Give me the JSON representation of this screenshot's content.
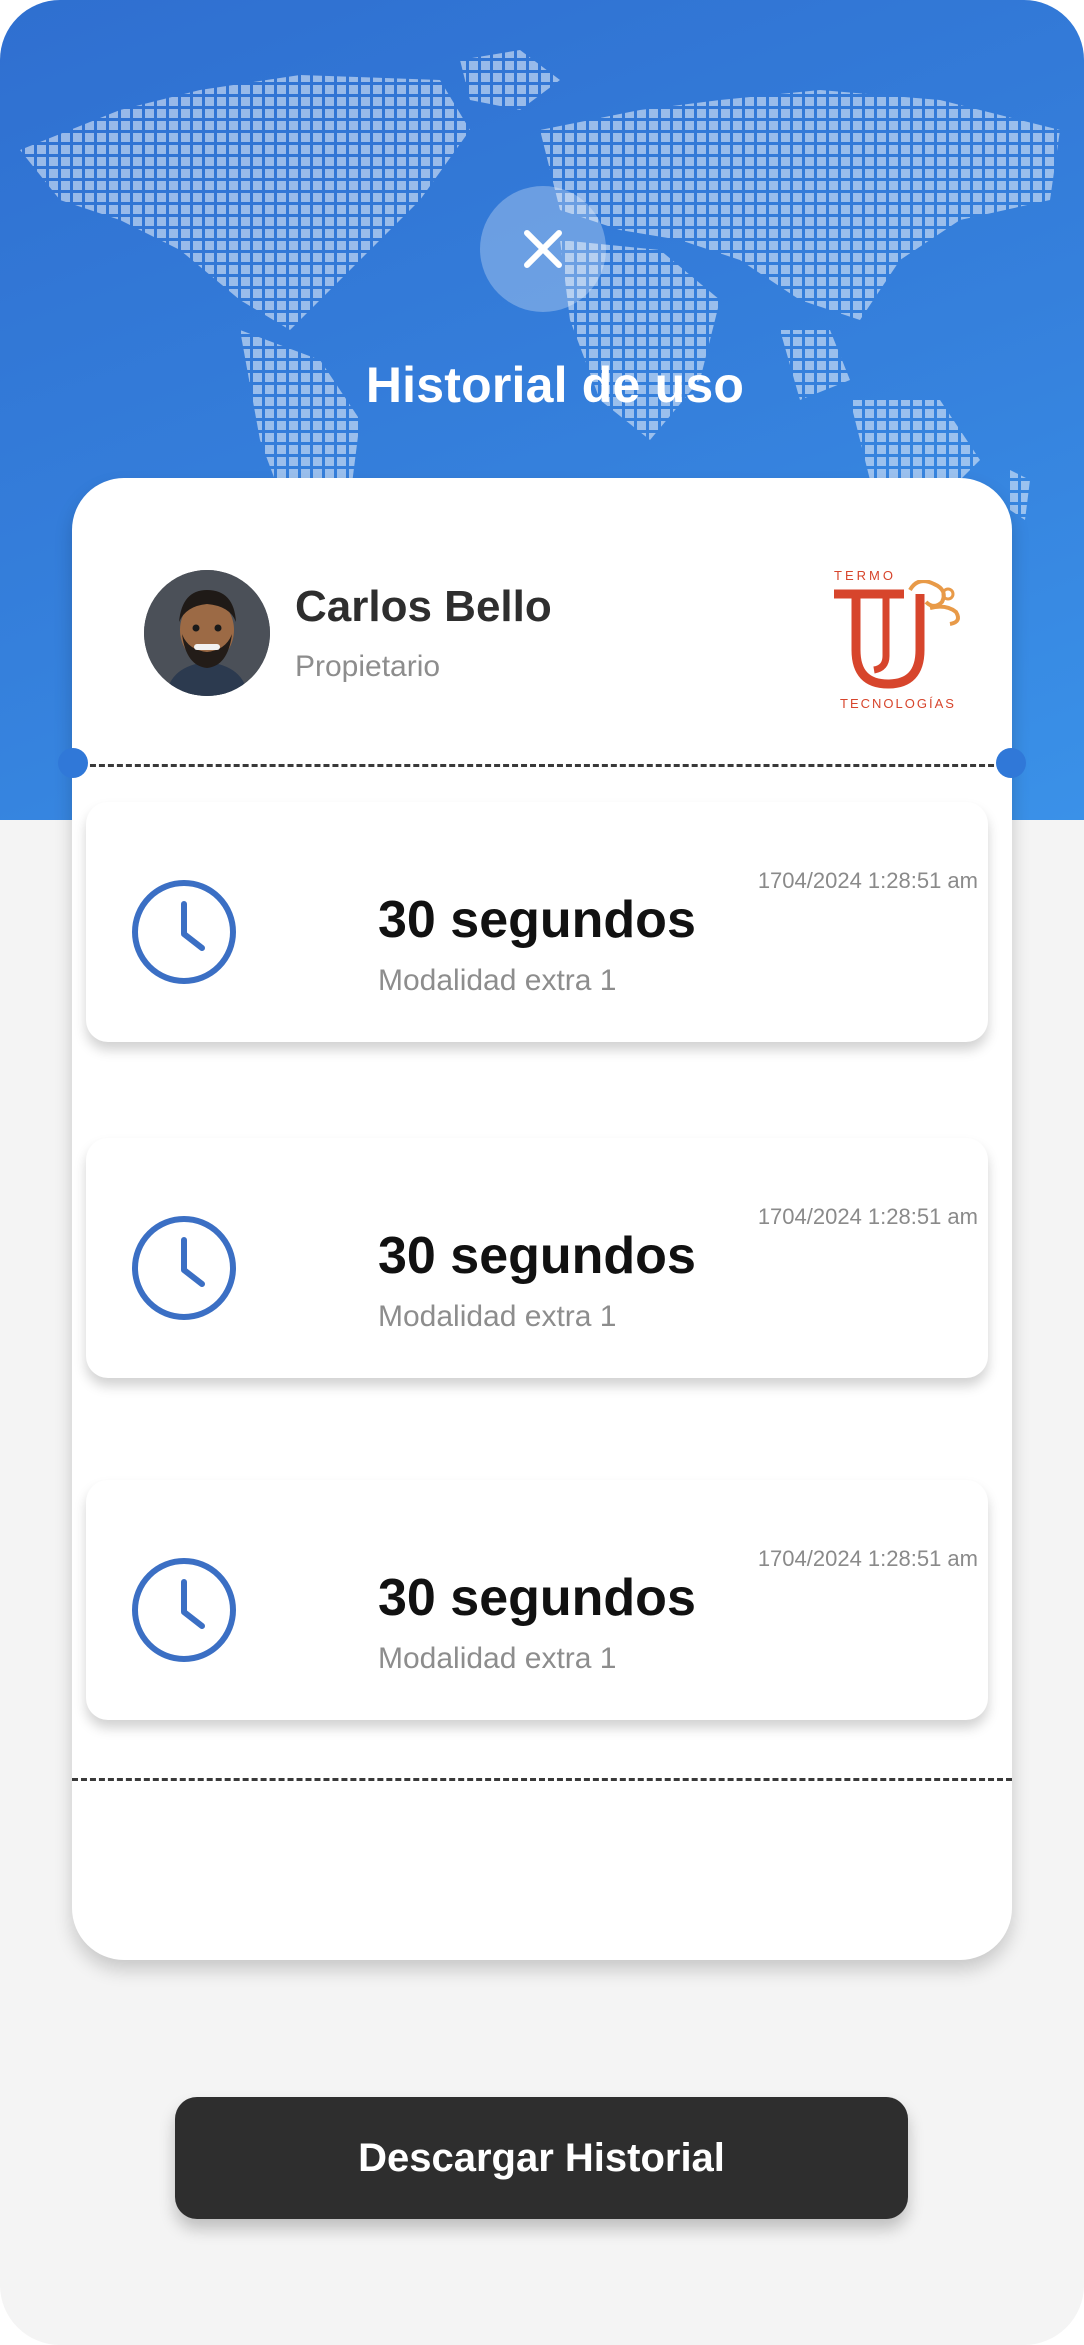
{
  "header": {
    "title": "Historial de uso",
    "close_icon": "close-icon"
  },
  "user": {
    "name": "Carlos Bello",
    "role": "Propietario"
  },
  "brand": {
    "logo_top": "TERMO",
    "logo_bottom": "TECNOLOGÍAS",
    "logo_color": "#d7452c"
  },
  "history": [
    {
      "date": "1704/2024 1:28:51 am",
      "duration": "30 segundos",
      "mode": "Modalidad extra 1"
    },
    {
      "date": "1704/2024 1:28:51 am",
      "duration": "30 segundos",
      "mode": "Modalidad extra 1"
    },
    {
      "date": "1704/2024 1:28:51 am",
      "duration": "30 segundos",
      "mode": "Modalidad extra 1"
    }
  ],
  "actions": {
    "download_label": "Descargar Historial"
  },
  "colors": {
    "primary_blue": "#3078d8",
    "dark_button": "#2e2e2e",
    "background": "#f4f4f4"
  }
}
